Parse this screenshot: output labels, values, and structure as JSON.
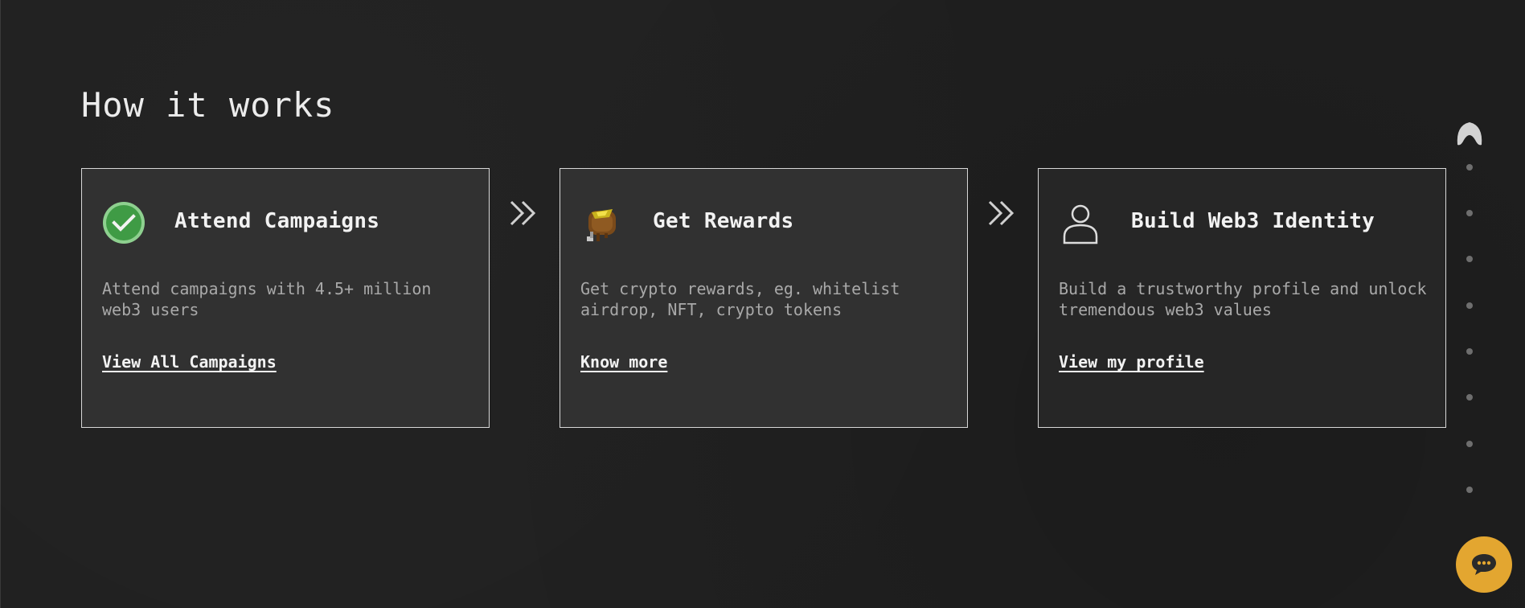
{
  "section": {
    "title": "How it works"
  },
  "cards": [
    {
      "icon": "check-circle-icon",
      "title": "Attend Campaigns",
      "description": "Attend campaigns with 4.5+ million web3 users",
      "link": "View All Campaigns"
    },
    {
      "icon": "reward-bag-icon",
      "title": "Get Rewards",
      "description": "Get crypto rewards, eg. whitelist airdrop, NFT, crypto tokens",
      "link": "Know more"
    },
    {
      "icon": "user-profile-icon",
      "title": "Build Web3 Identity",
      "description": "Build a trustworthy profile and unlock tremendous web3 values",
      "link": "View my profile"
    }
  ],
  "arrows": {
    "icon": "double-chevron-right-icon"
  },
  "side_nav": {
    "logo_icon": "brand-logo-icon",
    "dot_count": 8
  },
  "chat": {
    "icon": "chat-bubble-icon",
    "color": "#e3a630"
  },
  "colors": {
    "background": "#212121",
    "card_background": "#313131",
    "card_border": "#d8d8d8",
    "check_green": "#4caf50"
  }
}
